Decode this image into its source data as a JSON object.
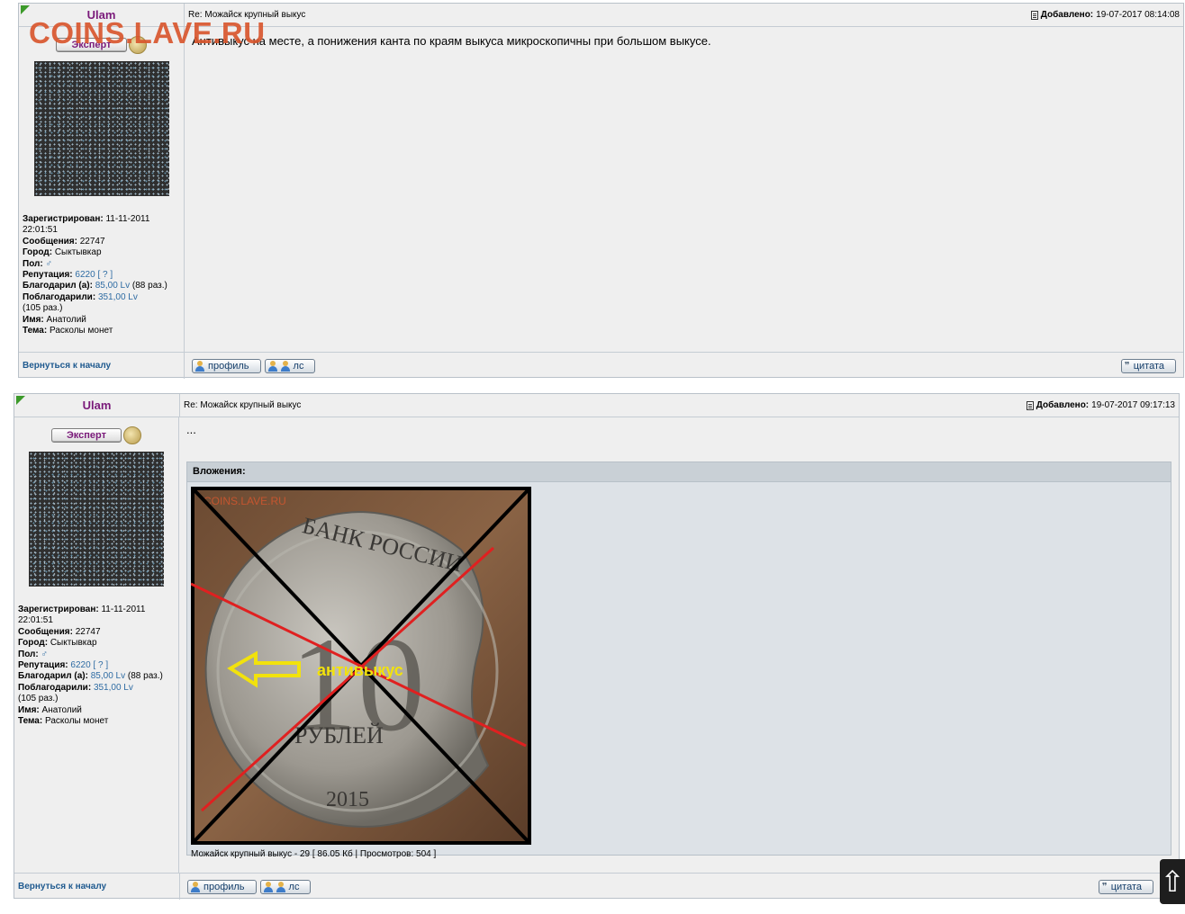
{
  "watermark": "COINS.LAVE.RU",
  "posts": [
    {
      "author": "Ulam",
      "subject": "Re: Можайск крупный выкус",
      "added_label": "Добавлено:",
      "added_date": "19-07-2017 08:14:08",
      "rank": "Эксперт",
      "registered_label": "Зарегистрирован:",
      "registered": "11-11-2011",
      "registered_time": "22:01:51",
      "messages_label": "Сообщения:",
      "messages": "22747",
      "city_label": "Город:",
      "city": "Сыктывкар",
      "gender_label": "Пол:",
      "gender_icon": "male-icon",
      "reputation_label": "Репутация:",
      "reputation": "6220",
      "reputation_q": "[ ? ]",
      "thanked_label": "Благодарил (а):",
      "thanked": "85,00 Lv",
      "thanked_times": "(88 раз.)",
      "thanked_by_label": "Поблагодарили:",
      "thanked_by": "351,00 Lv",
      "thanked_by_times": "(105 раз.)",
      "name_label": "Имя:",
      "name": "Анатолий",
      "topic_label": "Тема:",
      "topic": "Расколы монет",
      "body": "Антивыкус на месте, а понижения канта по краям выкуса микроскопичны при большом выкусе.",
      "back_link": "Вернуться к началу",
      "profile_btn": "профиль",
      "pm_btn": "лс",
      "quote_btn": "цитата"
    },
    {
      "author": "Ulam",
      "subject": "Re: Можайск крупный выкус",
      "added_label": "Добавлено:",
      "added_date": "19-07-2017 09:17:13",
      "rank": "Эксперт",
      "registered_label": "Зарегистрирован:",
      "registered": "11-11-2011",
      "registered_time": "22:01:51",
      "messages_label": "Сообщения:",
      "messages": "22747",
      "city_label": "Город:",
      "city": "Сыктывкар",
      "gender_label": "Пол:",
      "gender_icon": "male-icon",
      "reputation_label": "Репутация:",
      "reputation": "6220",
      "reputation_q": "[ ? ]",
      "thanked_label": "Благодарил (а):",
      "thanked": "85,00 Lv",
      "thanked_times": "(88 раз.)",
      "thanked_by_label": "Поблагодарили:",
      "thanked_by": "351,00 Lv",
      "thanked_by_times": "(105 раз.)",
      "name_label": "Имя:",
      "name": "Анатолий",
      "topic_label": "Тема:",
      "topic": "Расколы монет",
      "body": "...",
      "attachments_label": "Вложения:",
      "image": {
        "watermark": "COINS.LAVE.RU",
        "coin_top_text": "БАНК РОССИИ",
        "coin_value": "10",
        "coin_bottom_text": "РУБЛЕЙ",
        "coin_year": "2015",
        "annotation": "антивыкус"
      },
      "attachment_caption": "Можайск крупный выкус - 29 [ 86.05 Кб | Просмотров: 504 ]",
      "back_link": "Вернуться к началу",
      "profile_btn": "профиль",
      "pm_btn": "лс",
      "quote_btn": "цитата"
    }
  ],
  "scroll_top_icon": "arrow-up-icon"
}
